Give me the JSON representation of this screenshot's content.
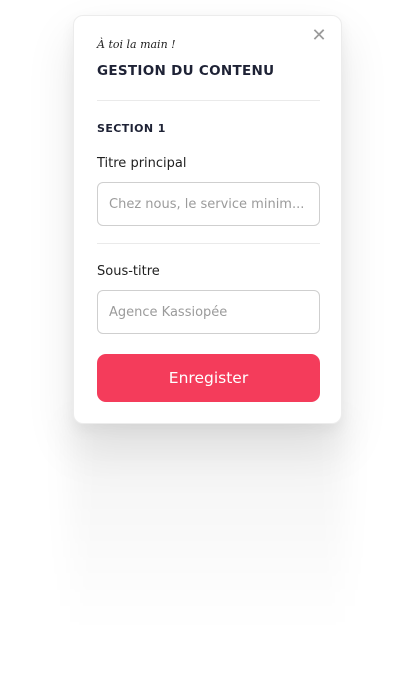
{
  "modal": {
    "tagline": "À toi la main !",
    "title": "GESTION DU CONTENU",
    "close_glyph": "✕"
  },
  "section": {
    "label": "SECTION 1"
  },
  "fields": [
    {
      "label": "Titre principal",
      "placeholder": "Chez nous, le service minim...",
      "value": ""
    },
    {
      "label": "Sous-titre",
      "placeholder": "Agence Kassiopée",
      "value": ""
    }
  ],
  "actions": {
    "save_label": "Enregister"
  },
  "colors": {
    "accent": "#f43c5b",
    "title_text": "#1e2235",
    "input_border": "#cfcfcf",
    "placeholder": "#9b9b9b"
  }
}
